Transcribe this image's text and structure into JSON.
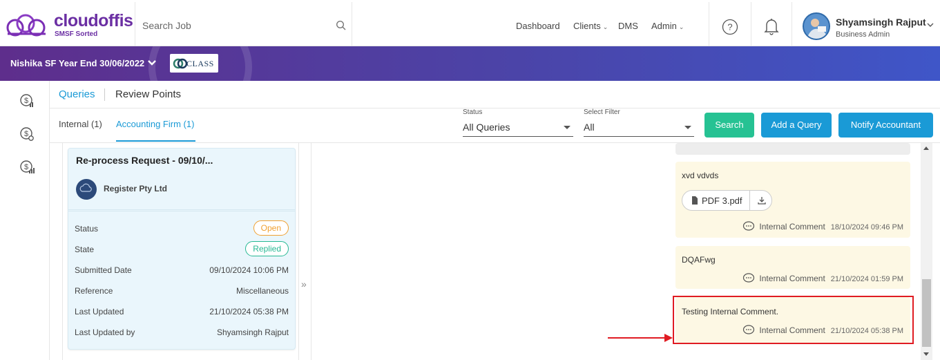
{
  "header": {
    "brand": "cloudoffis",
    "tagline": "SMSF Sorted",
    "search_placeholder": "Search Job",
    "nav": [
      {
        "label": "Dashboard"
      },
      {
        "label": "Clients"
      },
      {
        "label": "DMS"
      },
      {
        "label": "Admin"
      }
    ],
    "user_name": "Shyamsingh Rajput",
    "user_role": "Business Admin"
  },
  "banner": {
    "title": "Nishika SF Year End 30/06/2022",
    "badge_text": "CLASS"
  },
  "tabs": {
    "main": [
      {
        "label": "Queries"
      },
      {
        "label": "Review Points"
      }
    ],
    "sub": [
      {
        "label": "Internal (1)"
      },
      {
        "label": "Accounting Firm (1)"
      }
    ]
  },
  "filters": {
    "status_label": "Status",
    "status_value": "All Queries",
    "select_label": "Select Filter",
    "select_value": "All"
  },
  "buttons": {
    "search": "Search",
    "add_query": "Add a Query",
    "notify": "Notify Accountant"
  },
  "colors": {
    "accent_blue": "#1a9ad6",
    "search_green": "#26c293",
    "banner_purple": "#5e2e8c",
    "open_orange": "#f0a030",
    "replied_green": "#26b893"
  },
  "query_card": {
    "title": "Re-process Request - 09/10/...",
    "client": "Register Pty Ltd",
    "rows": [
      {
        "label": "Status",
        "value": "Open"
      },
      {
        "label": "State",
        "value": "Replied"
      },
      {
        "label": "Submitted Date",
        "value": "09/10/2024 10:06 PM"
      },
      {
        "label": "Reference",
        "value": "Miscellaneous"
      },
      {
        "label": "Last Updated",
        "value": "21/10/2024 05:38 PM"
      },
      {
        "label": "Last Updated by",
        "value": "Shyamsingh Rajput"
      }
    ]
  },
  "messages": [
    {
      "text": "xvd vdvds",
      "attachment": "PDF 3.pdf",
      "type": "Internal Comment",
      "date": "18/10/2024 09:46 PM"
    },
    {
      "text": "DQAFwg",
      "type": "Internal Comment",
      "date": "21/10/2024 01:59 PM"
    },
    {
      "text": "Testing Internal Comment.",
      "type": "Internal Comment",
      "date": "21/10/2024 05:38 PM"
    }
  ]
}
